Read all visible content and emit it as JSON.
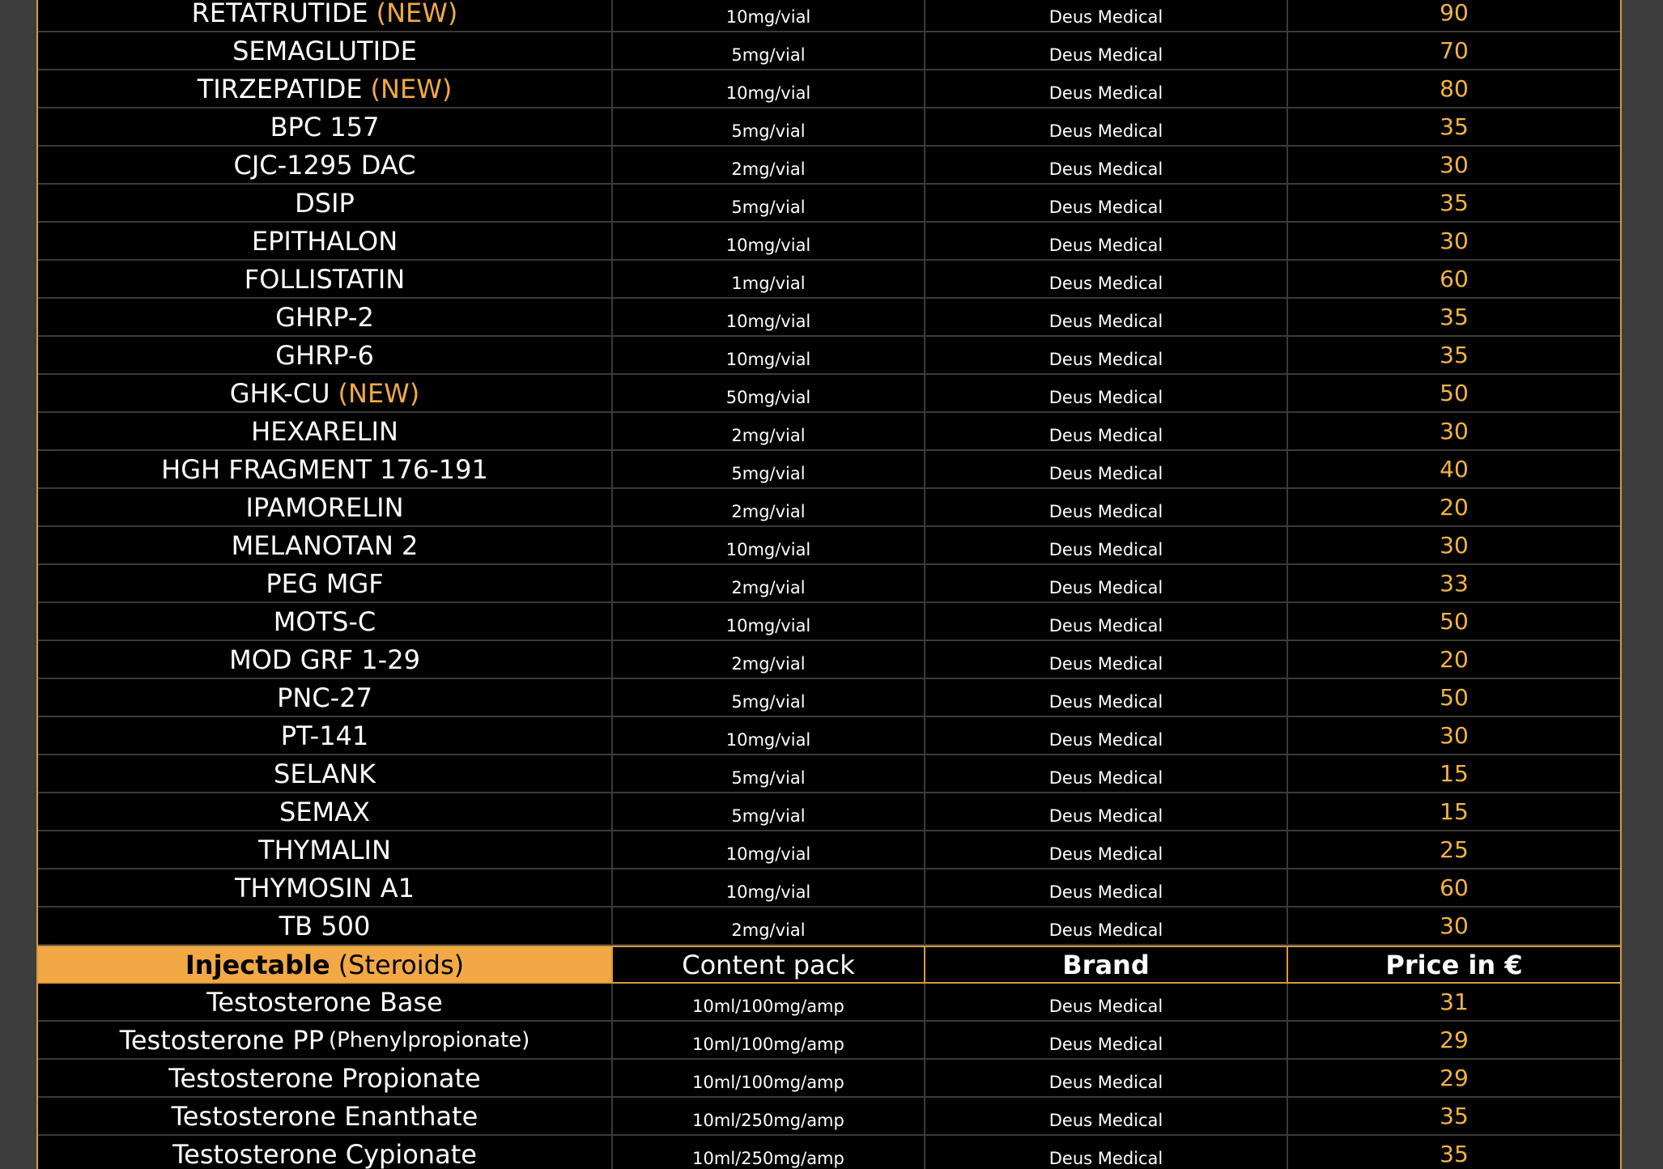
{
  "peptides": [
    {
      "name": "RETATRUTIDE",
      "tag": "(NEW)",
      "pack": "10mg/vial",
      "brand": "Deus Medical",
      "price": "90"
    },
    {
      "name": "SEMAGLUTIDE",
      "tag": "",
      "pack": "5mg/vial",
      "brand": "Deus Medical",
      "price": "70"
    },
    {
      "name": "TIRZEPATIDE",
      "tag": "(NEW)",
      "pack": "10mg/vial",
      "brand": "Deus Medical",
      "price": "80"
    },
    {
      "name": "BPC 157",
      "tag": "",
      "pack": "5mg/vial",
      "brand": "Deus Medical",
      "price": "35"
    },
    {
      "name": "CJC-1295 DAC",
      "tag": "",
      "pack": "2mg/vial",
      "brand": "Deus Medical",
      "price": "30"
    },
    {
      "name": "DSIP",
      "tag": "",
      "pack": "5mg/vial",
      "brand": "Deus Medical",
      "price": "35"
    },
    {
      "name": "EPITHALON",
      "tag": "",
      "pack": "10mg/vial",
      "brand": "Deus Medical",
      "price": "30"
    },
    {
      "name": "FOLLISTATIN",
      "tag": "",
      "pack": "1mg/vial",
      "brand": "Deus Medical",
      "price": "60"
    },
    {
      "name": "GHRP-2",
      "tag": "",
      "pack": "10mg/vial",
      "brand": "Deus Medical",
      "price": "35"
    },
    {
      "name": "GHRP-6",
      "tag": "",
      "pack": "10mg/vial",
      "brand": "Deus Medical",
      "price": "35"
    },
    {
      "name": "GHK-CU",
      "tag": "(NEW)",
      "pack": "50mg/vial",
      "brand": "Deus Medical",
      "price": "50"
    },
    {
      "name": "HEXARELIN",
      "tag": "",
      "pack": "2mg/vial",
      "brand": "Deus Medical",
      "price": "30"
    },
    {
      "name": "HGH FRAGMENT 176-191",
      "tag": "",
      "pack": "5mg/vial",
      "brand": "Deus Medical",
      "price": "40"
    },
    {
      "name": "IPAMORELIN",
      "tag": "",
      "pack": "2mg/vial",
      "brand": "Deus Medical",
      "price": "20"
    },
    {
      "name": "MELANOTAN 2",
      "tag": "",
      "pack": "10mg/vial",
      "brand": "Deus Medical",
      "price": "30"
    },
    {
      "name": "PEG MGF",
      "tag": "",
      "pack": "2mg/vial",
      "brand": "Deus Medical",
      "price": "33"
    },
    {
      "name": "MOTS-C",
      "tag": "",
      "pack": "10mg/vial",
      "brand": "Deus Medical",
      "price": "50"
    },
    {
      "name": "MOD GRF 1-29",
      "tag": "",
      "pack": "2mg/vial",
      "brand": "Deus Medical",
      "price": "20"
    },
    {
      "name": "PNC-27",
      "tag": "",
      "pack": "5mg/vial",
      "brand": "Deus Medical",
      "price": "50"
    },
    {
      "name": "PT-141",
      "tag": "",
      "pack": "10mg/vial",
      "brand": "Deus Medical",
      "price": "30"
    },
    {
      "name": "SELANK",
      "tag": "",
      "pack": "5mg/vial",
      "brand": "Deus Medical",
      "price": "15"
    },
    {
      "name": "SEMAX",
      "tag": "",
      "pack": "5mg/vial",
      "brand": "Deus Medical",
      "price": "15"
    },
    {
      "name": "THYMALIN",
      "tag": "",
      "pack": "10mg/vial",
      "brand": "Deus Medical",
      "price": "25"
    },
    {
      "name": "THYMOSIN A1",
      "tag": "",
      "pack": "10mg/vial",
      "brand": "Deus Medical",
      "price": "60"
    },
    {
      "name": "TB 500",
      "tag": "",
      "pack": "2mg/vial",
      "brand": "Deus Medical",
      "price": "30"
    }
  ],
  "section_header": {
    "category": "Injectable",
    "subcategory": "(Steroids)",
    "content_pack": "Content pack",
    "brand": "Brand",
    "price": "Price in €"
  },
  "steroids": [
    {
      "name": "Testosterone Base",
      "note": "",
      "pack": "10ml/100mg/amp",
      "brand": "Deus Medical",
      "price": "31"
    },
    {
      "name": "Testosterone  PP",
      "note": "(Phenylpropionate)",
      "pack": "10ml/100mg/amp",
      "brand": "Deus Medical",
      "price": "29"
    },
    {
      "name": "Testosterone Propionate",
      "note": "",
      "pack": "10ml/100mg/amp",
      "brand": "Deus Medical",
      "price": "29"
    },
    {
      "name": "Testosterone Enanthate",
      "note": "",
      "pack": "10ml/250mg/amp",
      "brand": "Deus Medical",
      "price": "35"
    },
    {
      "name": "Testosterone Cypionate",
      "note": "",
      "pack": "10ml/250mg/amp",
      "brand": "Deus Medical",
      "price": "35"
    }
  ]
}
